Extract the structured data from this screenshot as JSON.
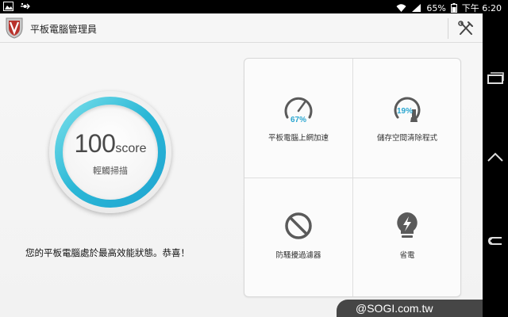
{
  "status_bar": {
    "battery_percent": "65%",
    "time": "下午 6:20"
  },
  "app": {
    "title": "平板電腦管理員"
  },
  "score": {
    "value": "100",
    "unit": "score",
    "action_label": "輕觸掃描"
  },
  "status_message": "您的平板電腦處於最高效能狀態。恭喜！",
  "tiles": [
    {
      "label": "平板電腦上網加速",
      "value": "67%",
      "icon": "speedometer-icon"
    },
    {
      "label": "儲存空間清除程式",
      "value": "19%",
      "icon": "storage-broom-icon"
    },
    {
      "label": "防騷擾過濾器",
      "icon": "block-icon"
    },
    {
      "label": "省電",
      "icon": "lightbulb-bolt-icon"
    }
  ],
  "watermark": "@SOGI.com.tw",
  "colors": {
    "accent": "#2aa6d0",
    "ring_light": "#7fe2ec",
    "icon_gray": "#5a5a5a"
  }
}
